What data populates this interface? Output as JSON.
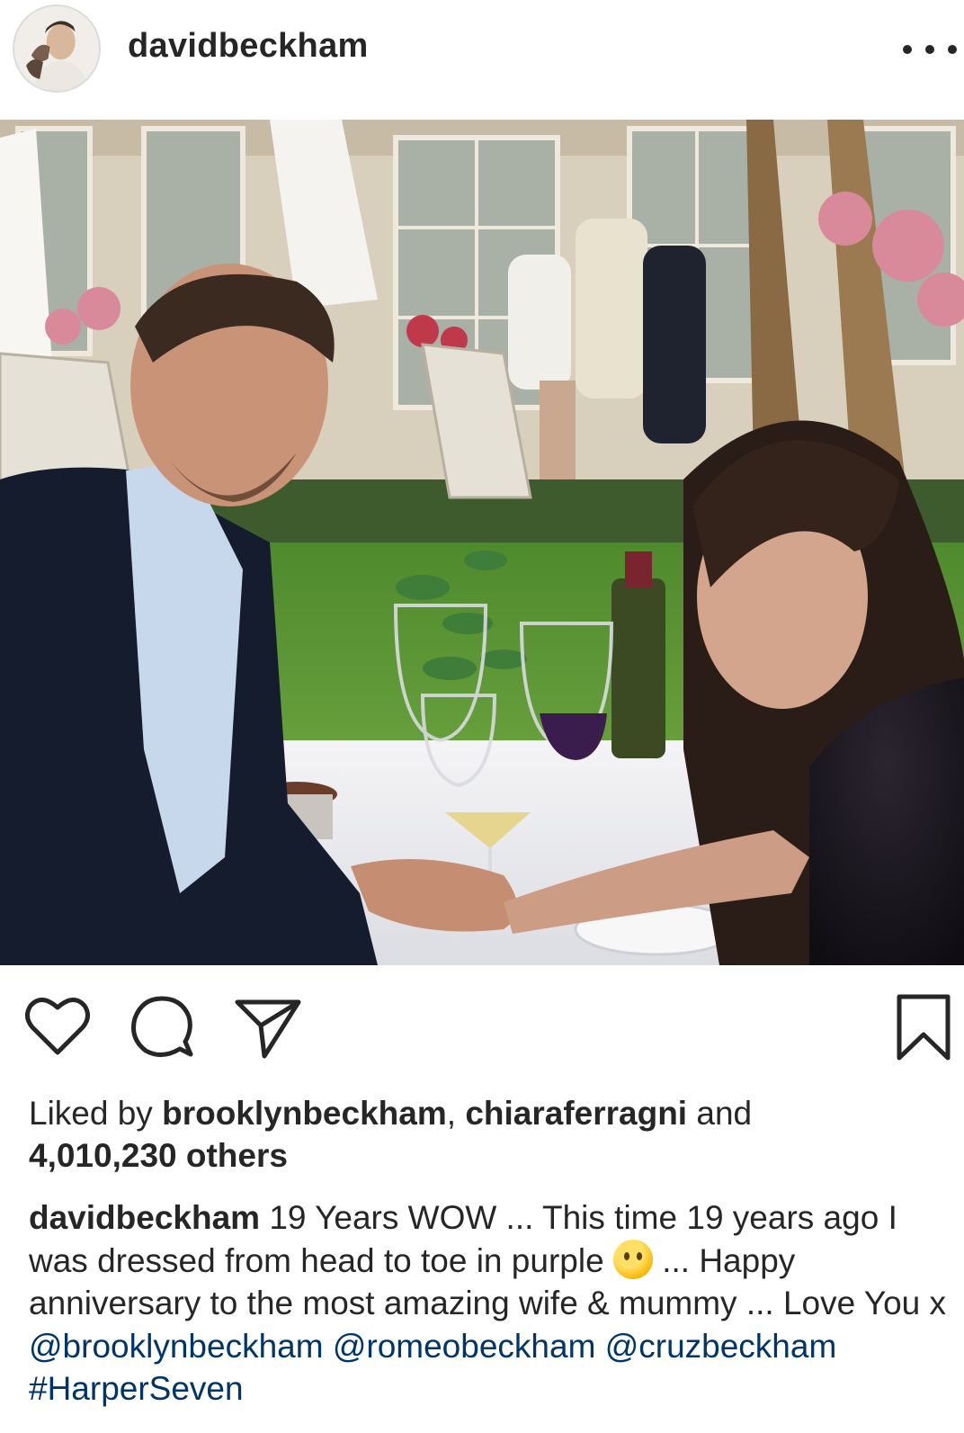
{
  "post": {
    "username": "davidbeckham",
    "more_icon": "more-horizontal-icon"
  },
  "actions": {
    "like_icon": "heart-icon",
    "comment_icon": "comment-icon",
    "share_icon": "send-icon",
    "save_icon": "bookmark-icon"
  },
  "likes": {
    "prefix": "Liked by ",
    "user1": "brooklynbeckham",
    "sep": ", ",
    "user2": "chiaraferragni",
    "and": " and",
    "count": "4,010,230 others"
  },
  "caption": {
    "author": "davidbeckham",
    "text1": " 19 Years WOW ... This time 19 years ago I was dressed from head to toe in purple ",
    "emoji": "thinking-face-emoji",
    "text2": " ... Happy anniversary to the most amazing wife & mummy ... Love You x ",
    "mention1": "@brooklynbeckham",
    "mention2": "@romeobeckham",
    "mention3": "@cruzbeckham",
    "hashtag": "#HarperSeven"
  },
  "colors": {
    "text": "#262626",
    "link": "#003569",
    "divider": "#dbdbdb"
  }
}
